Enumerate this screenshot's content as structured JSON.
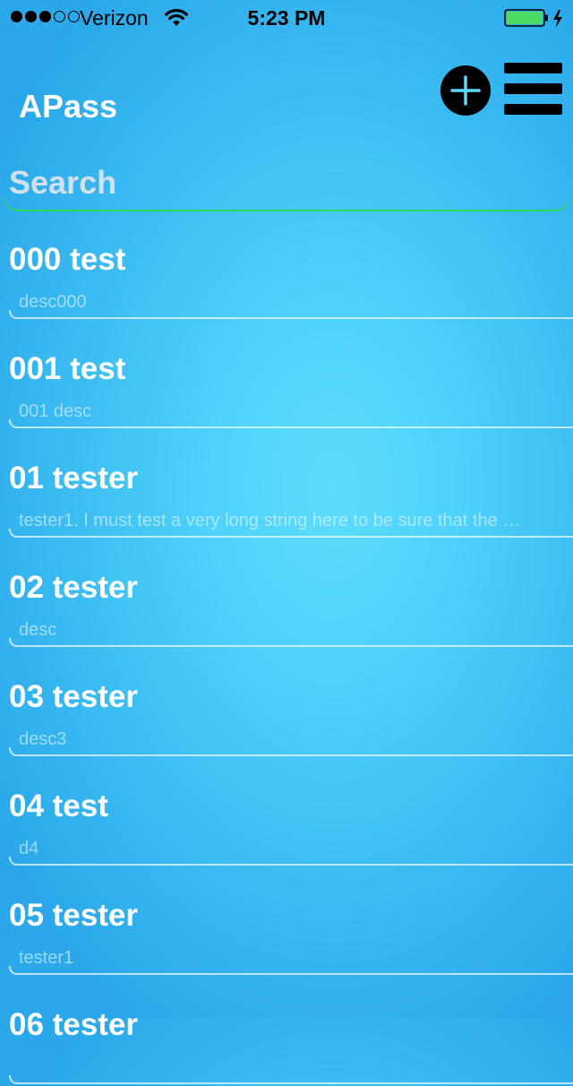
{
  "status_bar": {
    "carrier": "Verizon",
    "time": "5:23 PM",
    "signal_filled": 3,
    "signal_total": 5,
    "battery_level": 1.0,
    "battery_color": "#4cd964"
  },
  "nav": {
    "title": "APass",
    "add_icon": "plus-circle-icon",
    "menu_icon": "hamburger-menu-icon"
  },
  "search": {
    "placeholder": "Search",
    "value": "",
    "underline_color": "#22dd55"
  },
  "items": [
    {
      "title": "000 test",
      "desc": "desc000"
    },
    {
      "title": "001 test",
      "desc": "001 desc"
    },
    {
      "title": "01 tester",
      "desc": "tester1. I must test a very long string here to be sure that the …"
    },
    {
      "title": "02 tester",
      "desc": "desc"
    },
    {
      "title": "03 tester",
      "desc": "desc3"
    },
    {
      "title": "04 test",
      "desc": "d4"
    },
    {
      "title": "05 tester",
      "desc": "tester1"
    },
    {
      "title": "06 tester",
      "desc": ""
    }
  ]
}
